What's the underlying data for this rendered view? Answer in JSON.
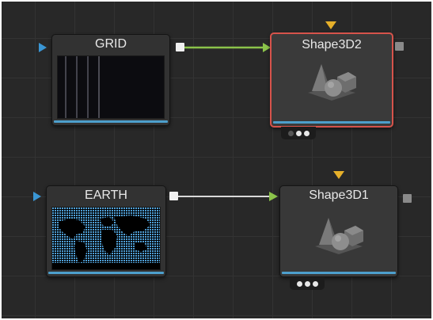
{
  "nodes": {
    "grid": {
      "title": "GRID"
    },
    "earth": {
      "title": "EARTH"
    },
    "shape3d2": {
      "title": "Shape3D2"
    },
    "shape3d1": {
      "title": "Shape3D1"
    }
  },
  "icons": {
    "input_port": "triangle-right-icon",
    "output_port": "square-icon",
    "scene_input": "triangle-down-icon",
    "shape": "3d-shapes-icon"
  },
  "colors": {
    "background": "#282828",
    "node": "#323232",
    "selected_border": "#d6534b",
    "connection_active": "#8bc34a",
    "connection_normal": "#d8d8d8",
    "input_port": "#3a96d4",
    "scene_port": "#e6b02a",
    "thumb_accent": "#4d9fcc"
  }
}
